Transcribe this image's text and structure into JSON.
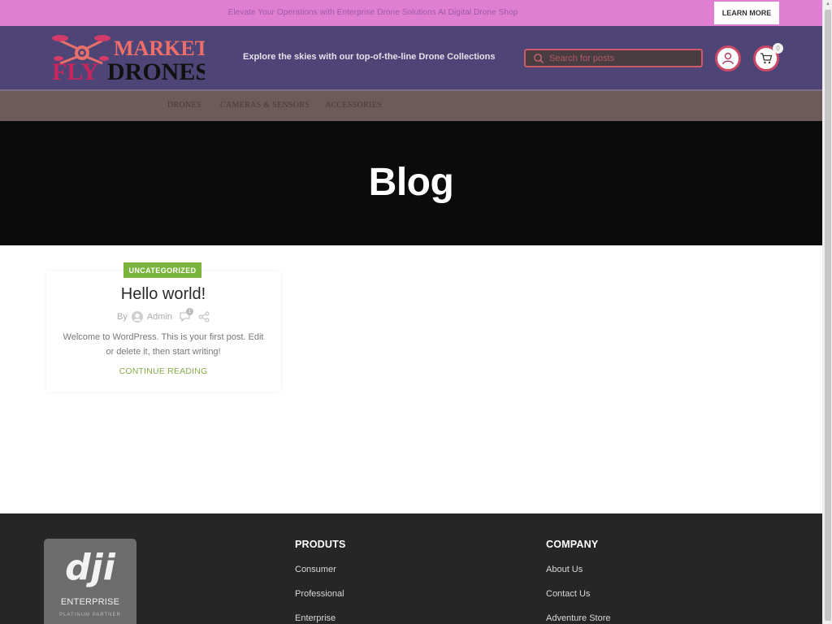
{
  "topbar": {
    "announcement": "Elevate Your Operations with Enterprise Drone Solutions At Digital Drone Shop",
    "cta_label": "LEARN MORE"
  },
  "header": {
    "logo": {
      "line1": "MARKET",
      "line2_a": "FLY",
      "line2_b": "DRONES",
      "icon": "drone-icon"
    },
    "tagline": "Explore the skies with our top-of-the-line Drone Collections",
    "search": {
      "placeholder": "Search for posts",
      "value": "",
      "icon": "search-icon"
    },
    "account_icon": "user-icon",
    "cart": {
      "icon": "cart-icon",
      "count": "0"
    }
  },
  "nav": {
    "items": [
      {
        "label": "DRONES"
      },
      {
        "label": "CAMERAS & SENSORS"
      },
      {
        "label": "ACCESSORIES"
      }
    ]
  },
  "hero": {
    "title": "Blog"
  },
  "post": {
    "category": "UNCATEGORIZED",
    "title": "Hello world!",
    "by_label": "By",
    "author": "Admin",
    "comment_count": "1",
    "excerpt": "Welcome to WordPress. This is your first post. Edit or delete it, then start writing!",
    "continue_label": "CONTINUE READING"
  },
  "footer": {
    "badge": {
      "brand": "dji",
      "line1": "ENTERPRISE",
      "line2": "PLATINUM PARTNER"
    },
    "columns": [
      {
        "heading": "PRODUTS",
        "links": [
          "Consumer",
          "Professional",
          "Enterprise"
        ]
      },
      {
        "heading": "COMPANY",
        "links": [
          "About Us",
          "Contact Us",
          "Adventure Store"
        ]
      }
    ]
  },
  "colors": {
    "topbar": "#e07fd1",
    "header": "#4e4476",
    "nav": "#6e5b59",
    "hero": "#0b0b0b",
    "accent_green": "#7ab43c",
    "accent_red": "#c84a66",
    "footer": "#262626"
  }
}
